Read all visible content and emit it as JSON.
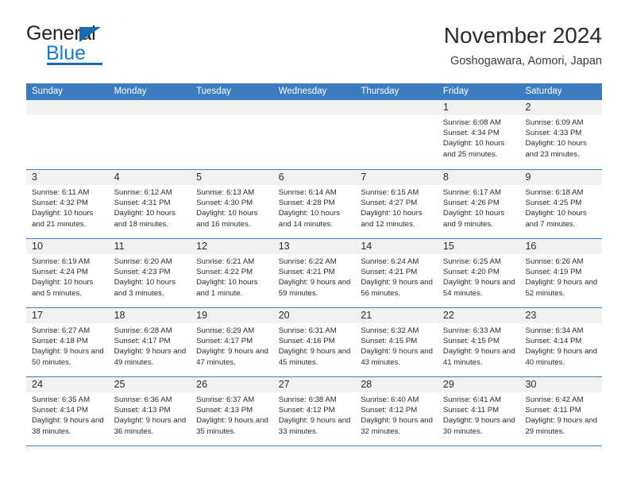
{
  "brand": {
    "name_part1": "General",
    "name_part2": "Blue",
    "accent_color": "#1c69b3"
  },
  "header": {
    "title": "November 2024",
    "subtitle": "Goshogawara, Aomori, Japan"
  },
  "calendar": {
    "header_bg": "#3d7dbf",
    "weekdays": [
      "Sunday",
      "Monday",
      "Tuesday",
      "Wednesday",
      "Thursday",
      "Friday",
      "Saturday"
    ],
    "weeks": [
      [
        {
          "day": "",
          "sunrise": "",
          "sunset": "",
          "daylight": "",
          "empty": true
        },
        {
          "day": "",
          "sunrise": "",
          "sunset": "",
          "daylight": "",
          "empty": true
        },
        {
          "day": "",
          "sunrise": "",
          "sunset": "",
          "daylight": "",
          "empty": true
        },
        {
          "day": "",
          "sunrise": "",
          "sunset": "",
          "daylight": "",
          "empty": true
        },
        {
          "day": "",
          "sunrise": "",
          "sunset": "",
          "daylight": "",
          "empty": true
        },
        {
          "day": "1",
          "sunrise": "Sunrise: 6:08 AM",
          "sunset": "Sunset: 4:34 PM",
          "daylight": "Daylight: 10 hours and 25 minutes.",
          "empty": false
        },
        {
          "day": "2",
          "sunrise": "Sunrise: 6:09 AM",
          "sunset": "Sunset: 4:33 PM",
          "daylight": "Daylight: 10 hours and 23 minutes.",
          "empty": false
        }
      ],
      [
        {
          "day": "3",
          "sunrise": "Sunrise: 6:11 AM",
          "sunset": "Sunset: 4:32 PM",
          "daylight": "Daylight: 10 hours and 21 minutes.",
          "empty": false
        },
        {
          "day": "4",
          "sunrise": "Sunrise: 6:12 AM",
          "sunset": "Sunset: 4:31 PM",
          "daylight": "Daylight: 10 hours and 18 minutes.",
          "empty": false
        },
        {
          "day": "5",
          "sunrise": "Sunrise: 6:13 AM",
          "sunset": "Sunset: 4:30 PM",
          "daylight": "Daylight: 10 hours and 16 minutes.",
          "empty": false
        },
        {
          "day": "6",
          "sunrise": "Sunrise: 6:14 AM",
          "sunset": "Sunset: 4:28 PM",
          "daylight": "Daylight: 10 hours and 14 minutes.",
          "empty": false
        },
        {
          "day": "7",
          "sunrise": "Sunrise: 6:15 AM",
          "sunset": "Sunset: 4:27 PM",
          "daylight": "Daylight: 10 hours and 12 minutes.",
          "empty": false
        },
        {
          "day": "8",
          "sunrise": "Sunrise: 6:17 AM",
          "sunset": "Sunset: 4:26 PM",
          "daylight": "Daylight: 10 hours and 9 minutes.",
          "empty": false
        },
        {
          "day": "9",
          "sunrise": "Sunrise: 6:18 AM",
          "sunset": "Sunset: 4:25 PM",
          "daylight": "Daylight: 10 hours and 7 minutes.",
          "empty": false
        }
      ],
      [
        {
          "day": "10",
          "sunrise": "Sunrise: 6:19 AM",
          "sunset": "Sunset: 4:24 PM",
          "daylight": "Daylight: 10 hours and 5 minutes.",
          "empty": false
        },
        {
          "day": "11",
          "sunrise": "Sunrise: 6:20 AM",
          "sunset": "Sunset: 4:23 PM",
          "daylight": "Daylight: 10 hours and 3 minutes.",
          "empty": false
        },
        {
          "day": "12",
          "sunrise": "Sunrise: 6:21 AM",
          "sunset": "Sunset: 4:22 PM",
          "daylight": "Daylight: 10 hours and 1 minute.",
          "empty": false
        },
        {
          "day": "13",
          "sunrise": "Sunrise: 6:22 AM",
          "sunset": "Sunset: 4:21 PM",
          "daylight": "Daylight: 9 hours and 59 minutes.",
          "empty": false
        },
        {
          "day": "14",
          "sunrise": "Sunrise: 6:24 AM",
          "sunset": "Sunset: 4:21 PM",
          "daylight": "Daylight: 9 hours and 56 minutes.",
          "empty": false
        },
        {
          "day": "15",
          "sunrise": "Sunrise: 6:25 AM",
          "sunset": "Sunset: 4:20 PM",
          "daylight": "Daylight: 9 hours and 54 minutes.",
          "empty": false
        },
        {
          "day": "16",
          "sunrise": "Sunrise: 6:26 AM",
          "sunset": "Sunset: 4:19 PM",
          "daylight": "Daylight: 9 hours and 52 minutes.",
          "empty": false
        }
      ],
      [
        {
          "day": "17",
          "sunrise": "Sunrise: 6:27 AM",
          "sunset": "Sunset: 4:18 PM",
          "daylight": "Daylight: 9 hours and 50 minutes.",
          "empty": false
        },
        {
          "day": "18",
          "sunrise": "Sunrise: 6:28 AM",
          "sunset": "Sunset: 4:17 PM",
          "daylight": "Daylight: 9 hours and 49 minutes.",
          "empty": false
        },
        {
          "day": "19",
          "sunrise": "Sunrise: 6:29 AM",
          "sunset": "Sunset: 4:17 PM",
          "daylight": "Daylight: 9 hours and 47 minutes.",
          "empty": false
        },
        {
          "day": "20",
          "sunrise": "Sunrise: 6:31 AM",
          "sunset": "Sunset: 4:16 PM",
          "daylight": "Daylight: 9 hours and 45 minutes.",
          "empty": false
        },
        {
          "day": "21",
          "sunrise": "Sunrise: 6:32 AM",
          "sunset": "Sunset: 4:15 PM",
          "daylight": "Daylight: 9 hours and 43 minutes.",
          "empty": false
        },
        {
          "day": "22",
          "sunrise": "Sunrise: 6:33 AM",
          "sunset": "Sunset: 4:15 PM",
          "daylight": "Daylight: 9 hours and 41 minutes.",
          "empty": false
        },
        {
          "day": "23",
          "sunrise": "Sunrise: 6:34 AM",
          "sunset": "Sunset: 4:14 PM",
          "daylight": "Daylight: 9 hours and 40 minutes.",
          "empty": false
        }
      ],
      [
        {
          "day": "24",
          "sunrise": "Sunrise: 6:35 AM",
          "sunset": "Sunset: 4:14 PM",
          "daylight": "Daylight: 9 hours and 38 minutes.",
          "empty": false
        },
        {
          "day": "25",
          "sunrise": "Sunrise: 6:36 AM",
          "sunset": "Sunset: 4:13 PM",
          "daylight": "Daylight: 9 hours and 36 minutes.",
          "empty": false
        },
        {
          "day": "26",
          "sunrise": "Sunrise: 6:37 AM",
          "sunset": "Sunset: 4:13 PM",
          "daylight": "Daylight: 9 hours and 35 minutes.",
          "empty": false
        },
        {
          "day": "27",
          "sunrise": "Sunrise: 6:38 AM",
          "sunset": "Sunset: 4:12 PM",
          "daylight": "Daylight: 9 hours and 33 minutes.",
          "empty": false
        },
        {
          "day": "28",
          "sunrise": "Sunrise: 6:40 AM",
          "sunset": "Sunset: 4:12 PM",
          "daylight": "Daylight: 9 hours and 32 minutes.",
          "empty": false
        },
        {
          "day": "29",
          "sunrise": "Sunrise: 6:41 AM",
          "sunset": "Sunset: 4:11 PM",
          "daylight": "Daylight: 9 hours and 30 minutes.",
          "empty": false
        },
        {
          "day": "30",
          "sunrise": "Sunrise: 6:42 AM",
          "sunset": "Sunset: 4:11 PM",
          "daylight": "Daylight: 9 hours and 29 minutes.",
          "empty": false
        }
      ]
    ]
  }
}
